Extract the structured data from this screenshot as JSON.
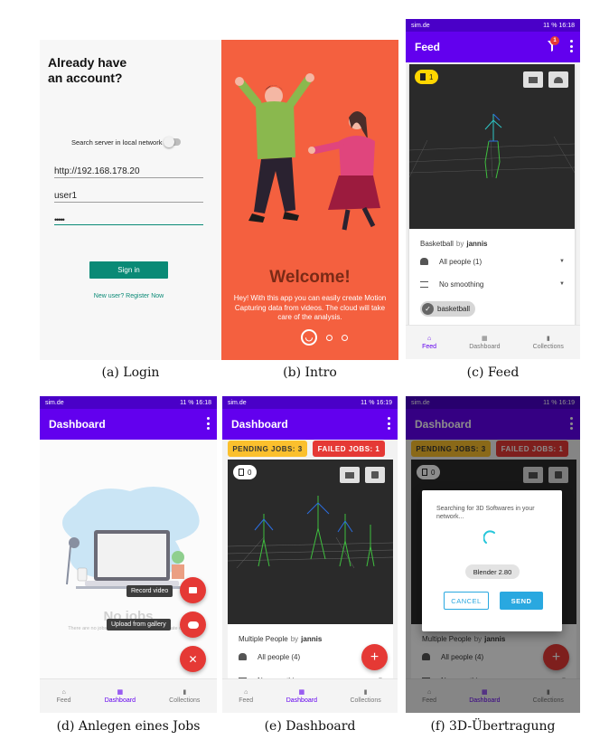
{
  "login": {
    "heading": "Already have\nan account?",
    "toggle_label": "Search server in local network",
    "server_value": "http://192.168.178.20",
    "user_value": "user1",
    "password_value": "•••••",
    "signin_label": "Sign in",
    "register_link": "New user? Register Now",
    "colors": {
      "accent": "#0a8a76"
    }
  },
  "intro": {
    "title": "Welcome!",
    "body": "Hey! With this app you can easily create Motion Capturing data from videos. The cloud will take care of the analysis.",
    "colors": {
      "background": "#f4603f"
    }
  },
  "status": {
    "carrier": "sim.de",
    "right_feed": "11 % 16:18",
    "right_dash": "11 % 16:18",
    "right_dash2": "11 % 16:19",
    "right_3d": "11 % 16:19"
  },
  "feed": {
    "title": "Feed",
    "notif_count": "1",
    "badge_count": "1",
    "card_title": "Basketball",
    "by": "by",
    "author": "jannis",
    "people_label": "All people (1)",
    "smoothing_label": "No smoothing",
    "tag_label": "basketball"
  },
  "nav": {
    "feed": "Feed",
    "dashboard": "Dashboard",
    "collections": "Collections"
  },
  "dashboard_empty": {
    "title": "Dashboard",
    "empty_title": "No jobs",
    "empty_text": "There are no jobs right now. Go ahead and create one.",
    "record_tooltip": "Record video",
    "upload_tooltip": "Upload from gallery"
  },
  "dashboard": {
    "title": "Dashboard",
    "pending": "PENDING JOBS: 3",
    "failed": "FAILED JOBS: 1",
    "badge_count": "0",
    "card_title": "Multiple People",
    "by": "by",
    "author": "jannis",
    "people_label": "All people (4)",
    "smoothing_label": "No smoothing"
  },
  "dialog": {
    "message": "Searching for 3D Softwares in your network...",
    "software_chip": "Blender 2.80",
    "cancel": "CANCEL",
    "send": "SEND"
  },
  "captions": {
    "a": "(a) Login",
    "b": "(b) Intro",
    "c": "(c) Feed",
    "d": "(d) Anlegen eines Jobs",
    "e": "(e) Dashboard",
    "f": "(f) 3D-Übertragung"
  },
  "colors": {
    "primary": "#6200ee",
    "statusbar": "#4a00c8",
    "pending": "#fbc02d",
    "failed": "#e53935",
    "fab": "#e53935",
    "send": "#29a8e0"
  }
}
